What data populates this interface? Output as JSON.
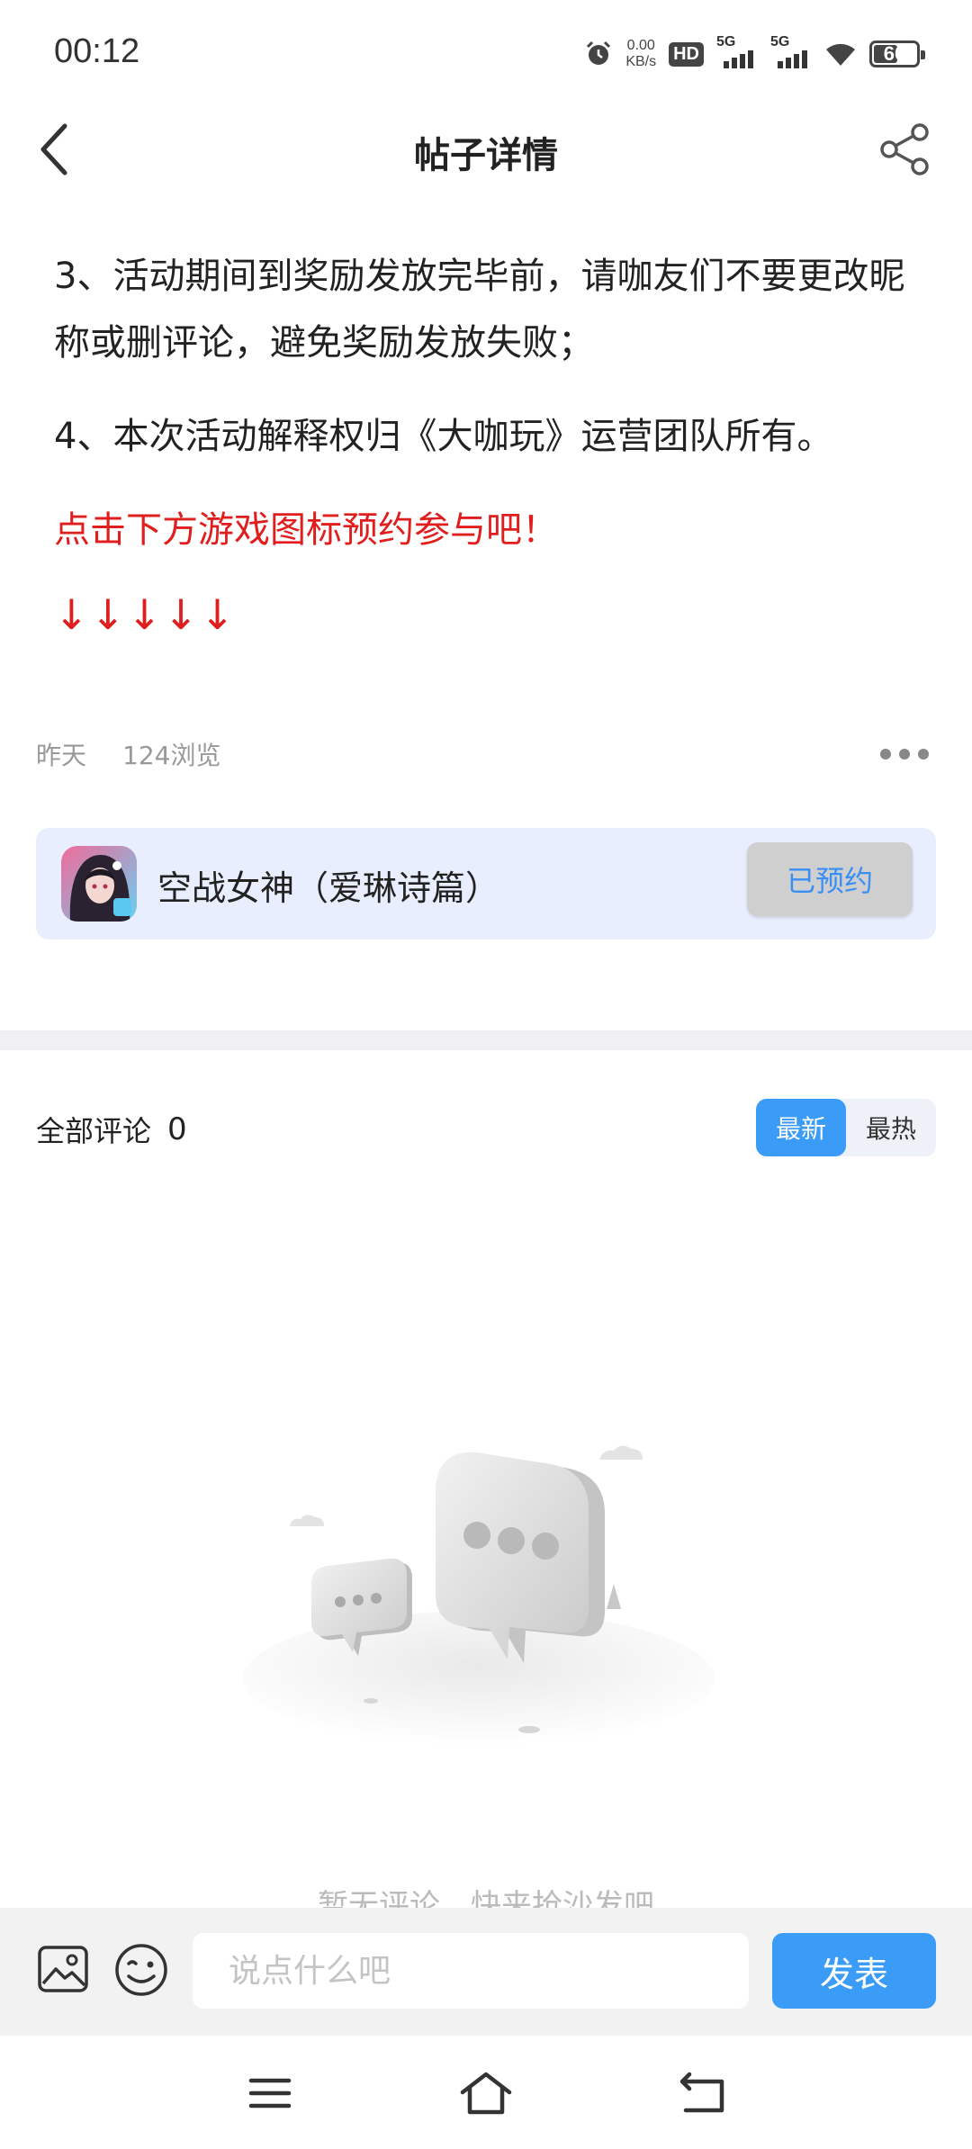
{
  "status_bar": {
    "time": "00:12",
    "speed_value": "0.00",
    "speed_unit": "KB/s",
    "hd_label": "HD",
    "signal_1": "5G",
    "signal_2": "5G",
    "battery": "60",
    "battery_level": 0.6
  },
  "header": {
    "title": "帖子详情"
  },
  "post": {
    "paragraphs": [
      "3、活动期间到奖励发放完毕前，请咖友们不要更改昵称或删评论，避免奖励发放失败；",
      "4、本次活动解释权归《大咖玩》运营团队所有。"
    ],
    "cta": "点击下方游戏图标预约参与吧！",
    "arrows": "↓↓↓↓↓"
  },
  "meta": {
    "date": "昨天",
    "views": "124浏览"
  },
  "game_card": {
    "name": "空战女神（爱琳诗篇）",
    "button": "已预约"
  },
  "comments": {
    "label": "全部评论",
    "count": "0",
    "sort_tabs": [
      {
        "label": "最新",
        "active": true
      },
      {
        "label": "最热",
        "active": false
      }
    ],
    "empty_text": "暂无评论，快来抢沙发吧"
  },
  "input_bar": {
    "placeholder": "说点什么吧",
    "publish": "发表"
  },
  "colors": {
    "accent": "#3a9cf6",
    "highlight_red": "#e01e1e",
    "card_bg": "#e8eefd"
  }
}
